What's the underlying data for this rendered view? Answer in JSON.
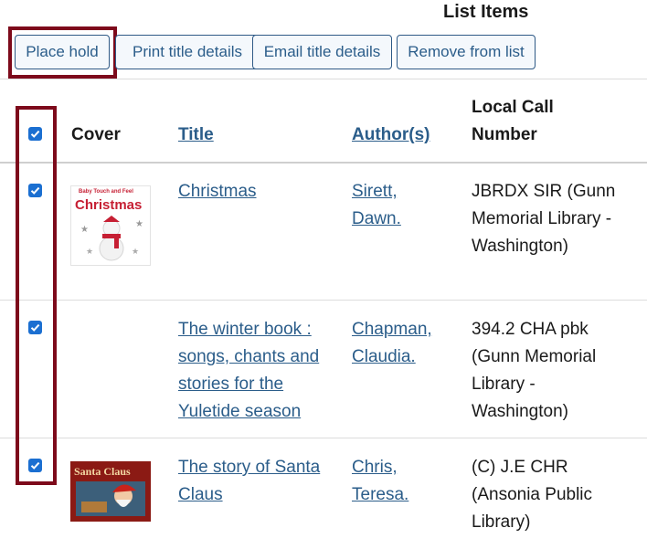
{
  "heading": "List Items",
  "toolbar": {
    "place_hold": "Place hold",
    "print_details": "Print title details",
    "email_details": "Email title details",
    "remove": "Remove from list"
  },
  "table": {
    "headers": {
      "cover": "Cover",
      "title": "Title",
      "author": "Author(s)",
      "call_line1": "Local Call",
      "call_line2": "Number"
    },
    "rows": [
      {
        "title": "Christmas",
        "author_lines": [
          "Sirett,",
          "Dawn."
        ],
        "call_lines": [
          "JBRDX SIR (Gunn",
          "Memorial Library -",
          "Washington)"
        ],
        "cover_text": "Christmas",
        "cover_small": "Baby Touch and Feel",
        "checked": true
      },
      {
        "title_lines": [
          "The winter book :",
          "songs, chants and",
          "stories for the",
          "Yuletide season"
        ],
        "author_lines": [
          "Chapman,",
          "Claudia."
        ],
        "call_lines": [
          "394.2 CHA pbk",
          "(Gunn Memorial",
          "Library -",
          "Washington)"
        ],
        "checked": true
      },
      {
        "title_lines": [
          "The story of Santa",
          "Claus"
        ],
        "author_lines": [
          "Chris,",
          "Teresa."
        ],
        "call_lines": [
          "(C) J.E CHR",
          "(Ansonia Public",
          "Library)"
        ],
        "cover_text": "Santa Claus",
        "checked": true
      }
    ]
  },
  "colors": {
    "accent": "#2b5d8a",
    "highlight": "#7d0a1b",
    "checkbox": "#1b6fd1"
  }
}
